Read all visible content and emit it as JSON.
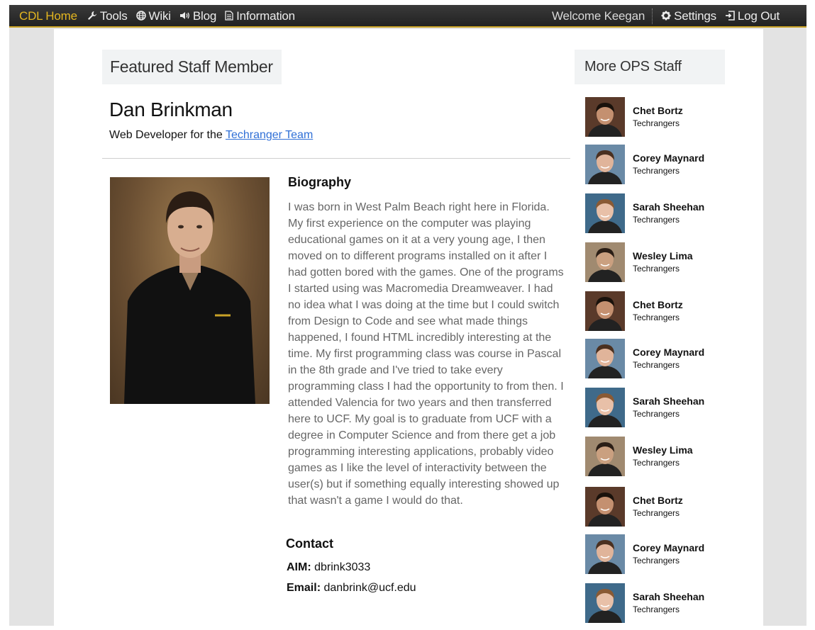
{
  "nav": {
    "home": "CDL Home",
    "tools": "Tools",
    "wiki": "Wiki",
    "blog": "Blog",
    "information": "Information",
    "welcome": "Welcome Keegan",
    "settings": "Settings",
    "logout": "Log Out",
    "accent_color": "#e4b620"
  },
  "featured": {
    "heading": "Featured Staff Member",
    "name": "Dan Brinkman",
    "role_prefix": "Web Developer for the",
    "team_link": "Techranger Team"
  },
  "biography": {
    "heading": "Biography",
    "text": "I was born in West Palm Beach right here in Florida. My first experience on the computer was playing educational games on it at a very young age, I then moved on to different programs installed on it after I had gotten bored with the games. One of the programs I started using was Macromedia Dreamweaver. I had no idea what I was doing at the time but I could switch from Design to Code and see what made things happened, I found HTML incredibly interesting at the time. My first programming class was course in Pascal in the 8th grade and I've tried to take every programming class I had the opportunity to from then. I attended Valencia for two years and then transferred here to UCF. My goal is to graduate from UCF with a degree in Computer Science and from there get a job programming interesting applications, probably video games as I like the level of interactivity between the user(s) but if something equally interesting showed up that wasn't a game I would do that."
  },
  "contact": {
    "heading": "Contact",
    "aim_label": "AIM:",
    "aim_value": "dbrink3033",
    "email_label": "Email:",
    "email_value": "danbrink@ucf.edu"
  },
  "more_staff": {
    "heading": "More OPS Staff",
    "items": [
      {
        "name": "Chet Bortz",
        "team": "Techrangers"
      },
      {
        "name": "Corey Maynard",
        "team": "Techrangers"
      },
      {
        "name": "Sarah Sheehan",
        "team": "Techrangers"
      },
      {
        "name": "Wesley Lima",
        "team": "Techrangers"
      },
      {
        "name": "Chet Bortz",
        "team": "Techrangers"
      },
      {
        "name": "Corey Maynard",
        "team": "Techrangers"
      },
      {
        "name": "Sarah Sheehan",
        "team": "Techrangers"
      },
      {
        "name": "Wesley Lima",
        "team": "Techrangers"
      },
      {
        "name": "Chet Bortz",
        "team": "Techrangers"
      },
      {
        "name": "Corey Maynard",
        "team": "Techrangers"
      },
      {
        "name": "Sarah Sheehan",
        "team": "Techrangers"
      }
    ]
  }
}
